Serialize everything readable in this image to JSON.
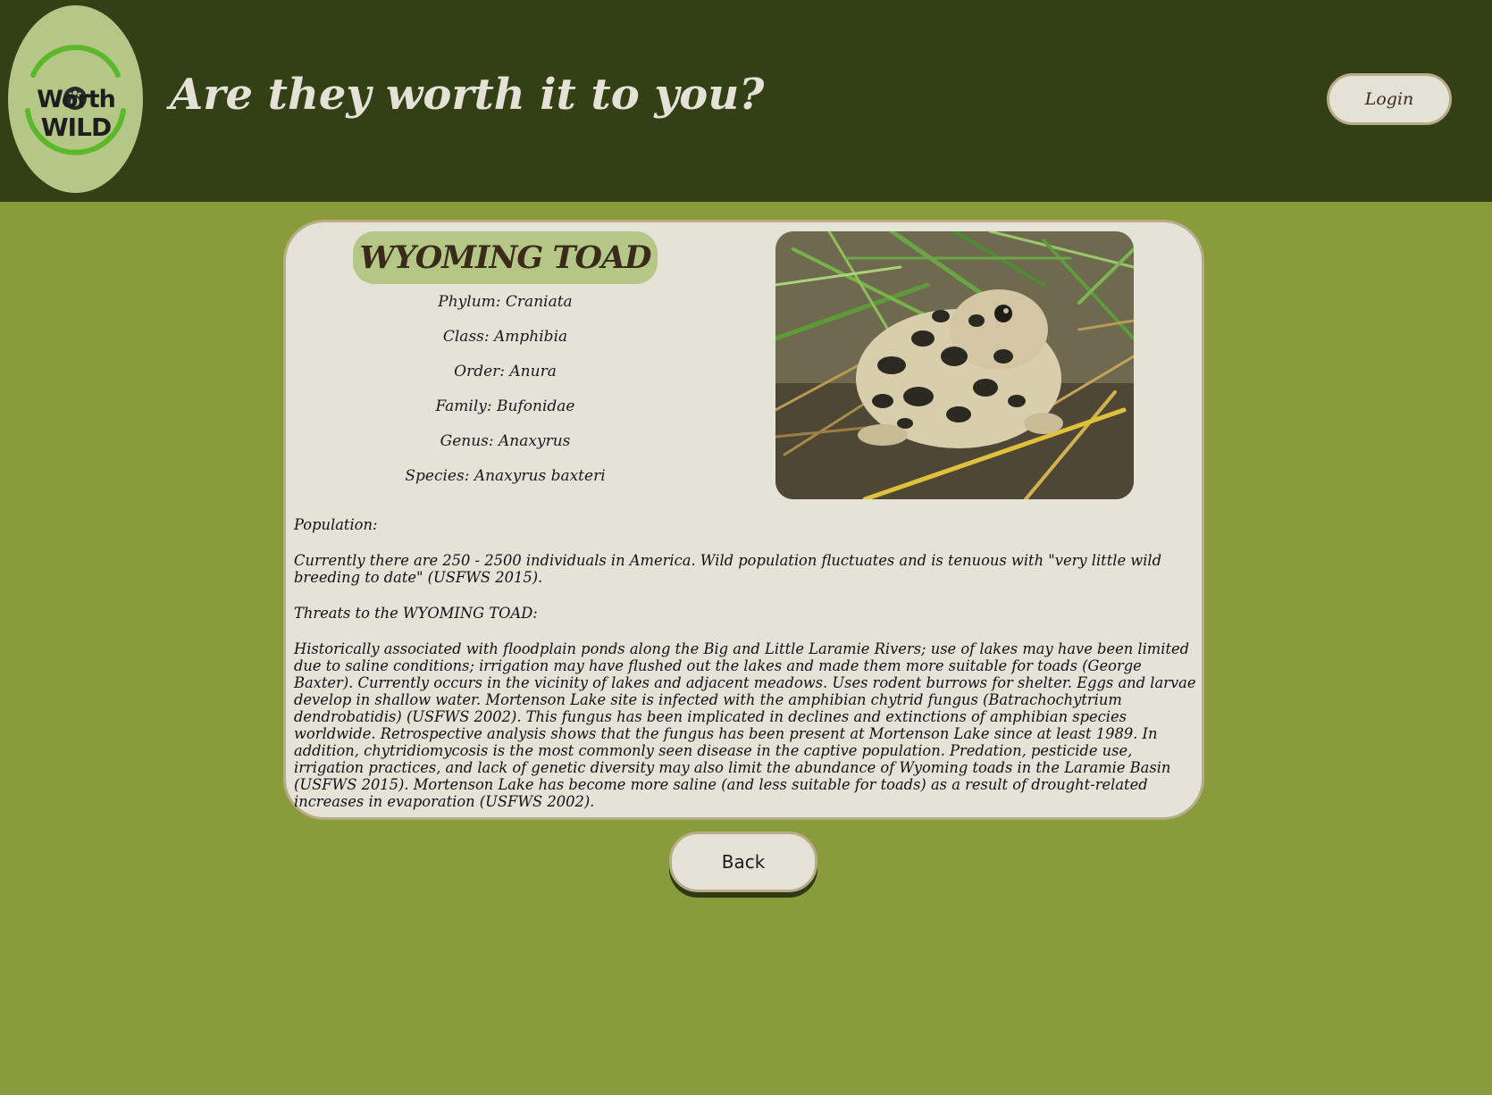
{
  "header": {
    "logo_text_top": "Worth",
    "logo_text_bottom": "WILD",
    "tagline": "Are they worth it to you?",
    "login_label": "Login"
  },
  "animal": {
    "name": "WYOMING TOAD",
    "taxonomy": {
      "phylum": "Phylum: Craniata",
      "class": "Class: Amphibia",
      "order": "Order: Anura",
      "family": "Family: Bufonidae",
      "genus": "Genus: Anaxyrus",
      "species": "Species: Anaxyrus baxteri"
    },
    "photo_icon": "toad-photo"
  },
  "details": {
    "population_heading": "Population:",
    "population_text": "Currently there are 250 - 2500 individuals in America. Wild population fluctuates and is tenuous with \"very little wild breeding to date\" (USFWS 2015).",
    "threats_heading": "Threats to the WYOMING TOAD:",
    "threats_text": "Historically associated with floodplain ponds along the Big and Little Laramie Rivers; use of lakes may have been limited due to saline conditions; irrigation may have flushed out the lakes and made them more suitable for toads (George Baxter). Currently occurs in the vicinity of lakes and adjacent meadows. Uses rodent burrows for shelter. Eggs and larvae develop in shallow water. Mortenson Lake site is infected with the amphibian chytrid fungus (Batrachochytrium dendrobatidis) (USFWS 2002). This fungus has been implicated in declines and extinctions of amphibian species worldwide. Retrospective analysis shows that the fungus has been present at Mortenson Lake since at least 1989. In addition, chytridiomycosis is the most commonly seen disease in the captive population. Predation, pesticide use, irrigation practices, and lack of genetic diversity may also limit the abundance of Wyoming toads in the Laramie Basin (USFWS 2015). Mortenson Lake has become more saline (and less suitable for toads) as a result of drought-related increases in evaporation (USFWS 2002)."
  },
  "footer": {
    "back_label": "Back"
  },
  "colors": {
    "header_bg": "#334015",
    "page_bg": "#8a9b3c",
    "card_bg": "#e5e2d8",
    "accent": "#b5c787",
    "logo_green": "#5cb82a"
  }
}
